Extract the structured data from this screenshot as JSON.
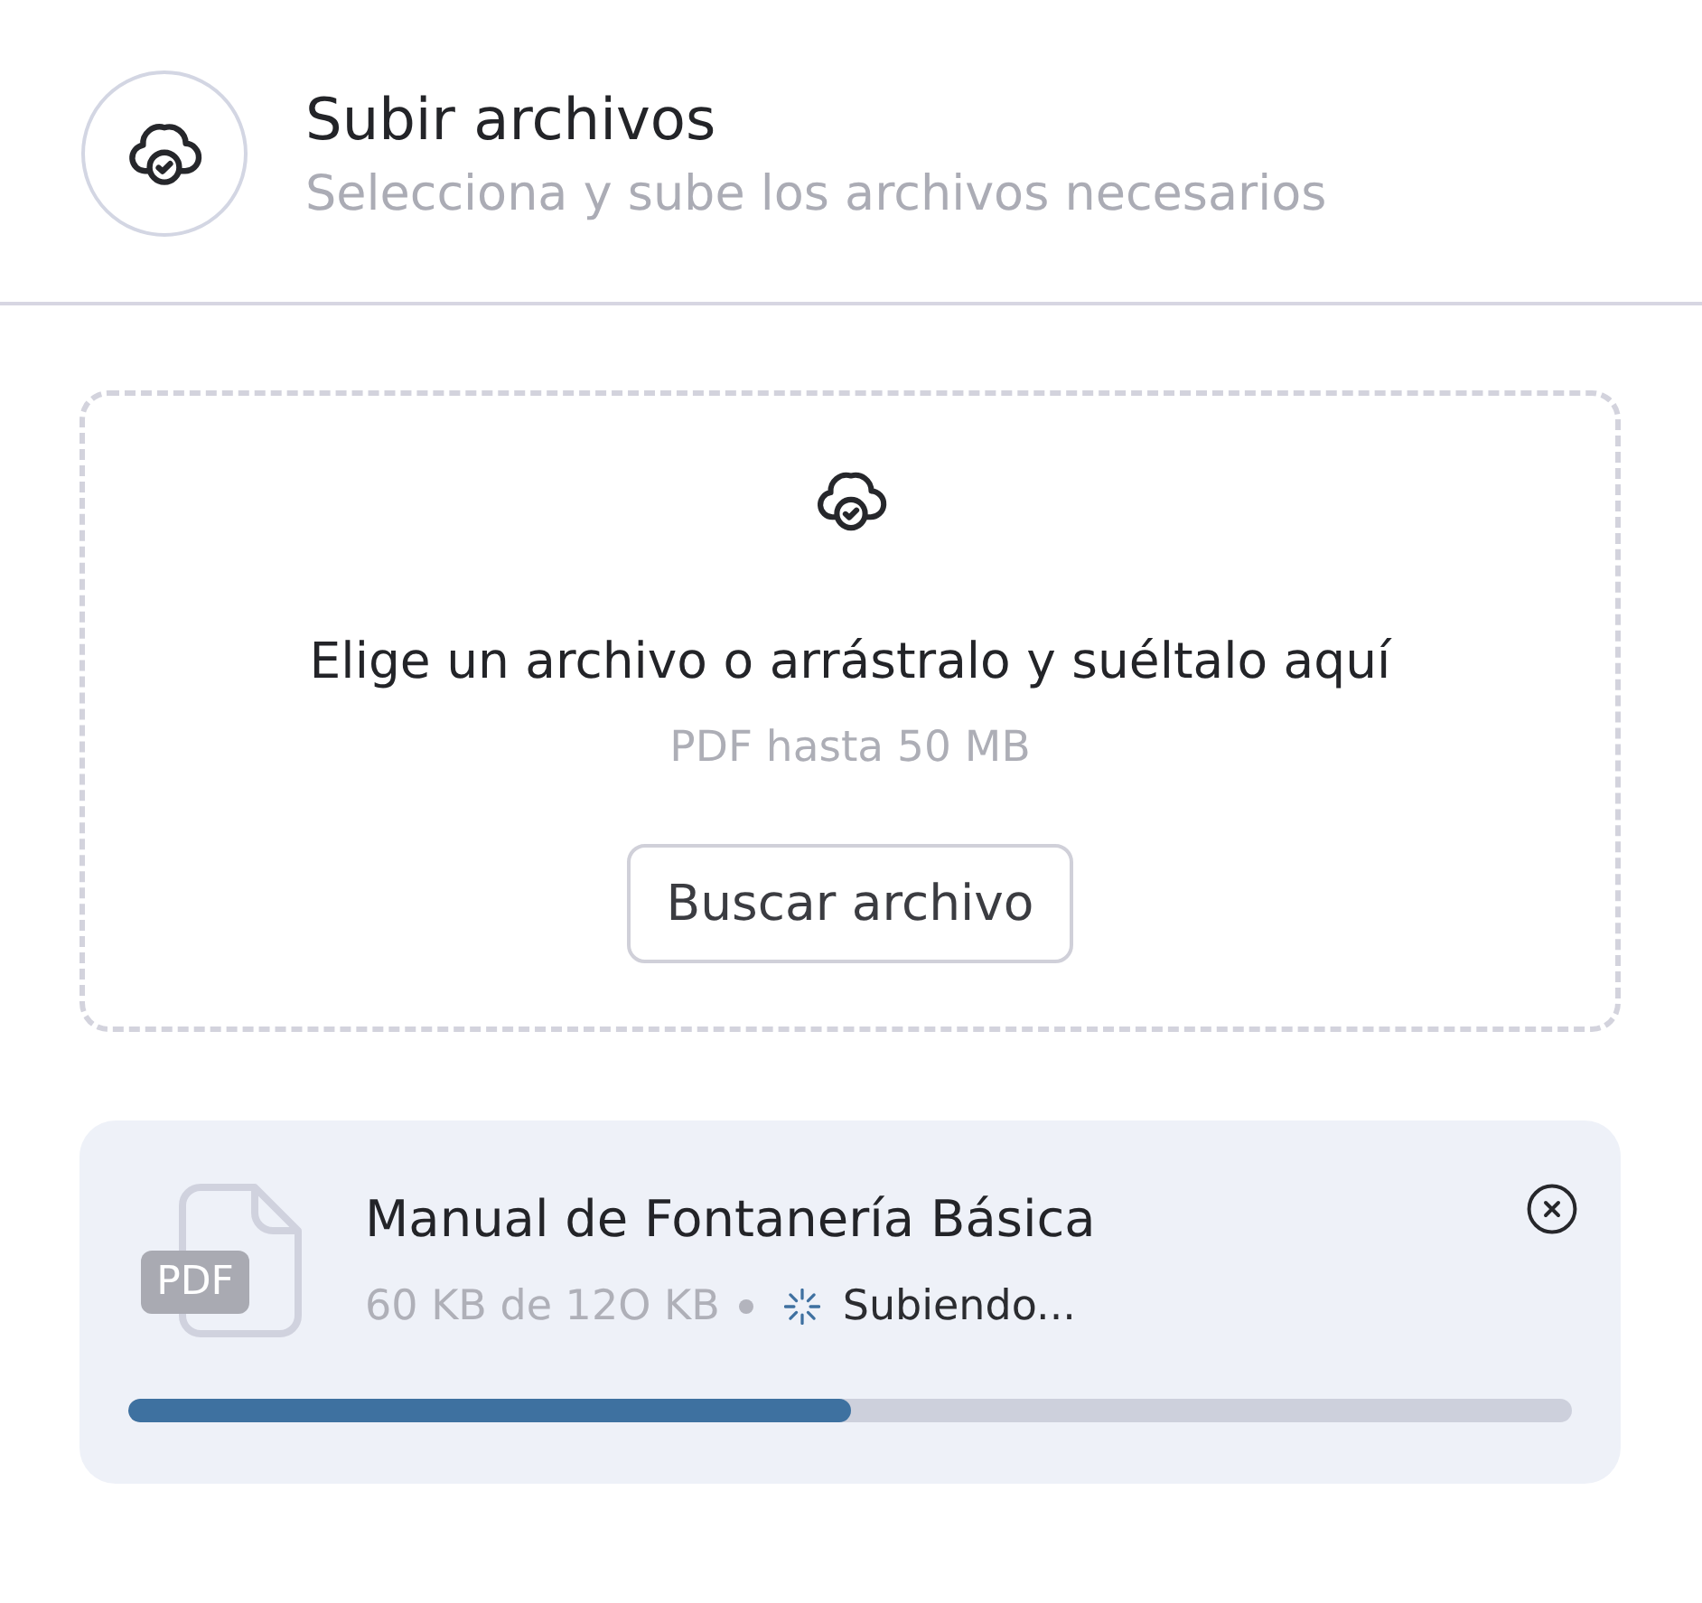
{
  "header": {
    "title": "Subir archivos",
    "subtitle": "Selecciona y sube los archivos necesarios"
  },
  "dropzone": {
    "prompt": "Elige un archivo o arrástralo y suéltalo aquí",
    "hint": "PDF hasta 50 MB",
    "button": "Buscar archivo"
  },
  "files": [
    {
      "name": "Manual de Fontanería Básica",
      "type_badge": "PDF",
      "size_info": "60 KB de 12O KB",
      "uploading": true,
      "status": "Subiendo...",
      "level": 0.5
    }
  ]
}
